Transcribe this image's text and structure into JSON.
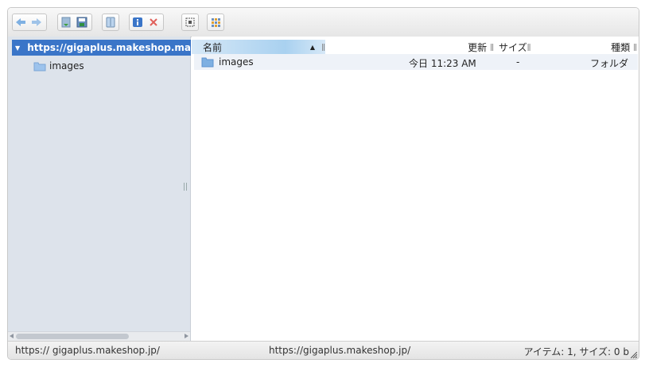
{
  "toolbar": {
    "buttons": [
      {
        "name": "back-button",
        "icon": "back-arrow-icon"
      },
      {
        "name": "forward-button",
        "icon": "forward-arrow-icon"
      },
      {
        "name": "download-button",
        "icon": "download-icon"
      },
      {
        "name": "save-button",
        "icon": "save-icon"
      },
      {
        "name": "copy-button",
        "icon": "copy-icon"
      },
      {
        "name": "info-button",
        "icon": "info-icon"
      },
      {
        "name": "delete-button",
        "icon": "delete-x-icon"
      },
      {
        "name": "select-button",
        "icon": "select-frame-icon"
      },
      {
        "name": "view-grid-button",
        "icon": "grid-view-icon"
      }
    ]
  },
  "sidebar": {
    "root_label": "https://gigaplus.makeshop.ma",
    "children": [
      {
        "label": "images"
      }
    ]
  },
  "file_list": {
    "columns": {
      "name": "名前",
      "modified": "更新",
      "size": "サイズ",
      "kind": "種類"
    },
    "rows": [
      {
        "name": "images",
        "modified": "今日 11:23 AM",
        "size": "-",
        "kind": "フォルダ"
      }
    ]
  },
  "statusbar": {
    "left": "https:// gigaplus.makeshop.jp/",
    "center": "https://gigaplus.makeshop.jp/",
    "right": "アイテム: 1, サイズ: 0 b"
  },
  "colors": {
    "selection": "#3a75c8",
    "sidebar_bg": "#dde3eb",
    "column_highlight": "#a9d1f0",
    "folder": "#7fb0e2"
  }
}
